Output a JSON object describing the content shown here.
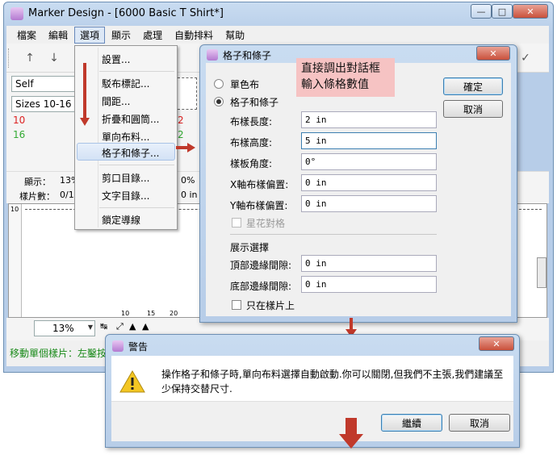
{
  "main_window": {
    "title": "Marker Design - [6000 Basic T Shirt*]",
    "menu": [
      "檔案",
      "編輯",
      "選項",
      "顯示",
      "處理",
      "自動排料",
      "幫助"
    ],
    "left_panel": {
      "combo1": "Self",
      "combo2": "Sizes 10-16",
      "row1_left": "10",
      "row1_right": "2",
      "row2_left": "16",
      "row2_right": "2"
    },
    "stats": {
      "display_label": "顯示：",
      "display_val": "13%",
      "display_val2": "0%",
      "pieces_label": "樣片數：",
      "pieces_val": "0/1",
      "pieces_val2": "0 in"
    },
    "ruler_labels": [
      "10",
      "10",
      "15",
      "20"
    ],
    "zoom": "13%",
    "status_text": "移動單個樣片：左鑿按"
  },
  "options_menu": {
    "items": [
      "設置...",
      "駁布標記...",
      "間距...",
      "折疊和圓筒...",
      "單向布料...",
      "格子和條子...",
      "剪口目錄...",
      "文字目錄...",
      "鎖定導線"
    ]
  },
  "grid_dialog": {
    "title": "格子和條子",
    "annotation_line1": "直接調出對話框",
    "annotation_line2": "輸入條格數值",
    "radio_plain": "單色布",
    "radio_grid": "格子和條子",
    "fields": [
      {
        "label": "布樣長度:",
        "value": "2 in"
      },
      {
        "label": "布樣高度:",
        "value": "5 in"
      },
      {
        "label": "樣板角度:",
        "value": "0°"
      },
      {
        "label": "X軸布樣偏置:",
        "value": "0 in"
      },
      {
        "label": "Y軸布樣偏置:",
        "value": "0 in"
      }
    ],
    "star_check": "星花對格",
    "display_section": "展示選擇",
    "top_margin": {
      "label": "頂部邊緣間隙:",
      "value": "0 in"
    },
    "bottom_margin": {
      "label": "底部邊緣間隙:",
      "value": "0 in"
    },
    "only_pieces": "只在樣片上",
    "ok": "確定",
    "cancel": "取消"
  },
  "warning_dialog": {
    "title": "警告",
    "message_line1": "操作格子和條子時,單向布料選擇自動啟動.你可以關閉,但我們不主張,我們建議至",
    "message_line2": "少保持交替尺寸.",
    "continue": "繼續",
    "cancel": "取消"
  },
  "colors": {
    "accent_red": "#c0392b",
    "annotation_bg": "#f6c3c3",
    "number_red": "#d22",
    "number_green": "#3a3"
  }
}
